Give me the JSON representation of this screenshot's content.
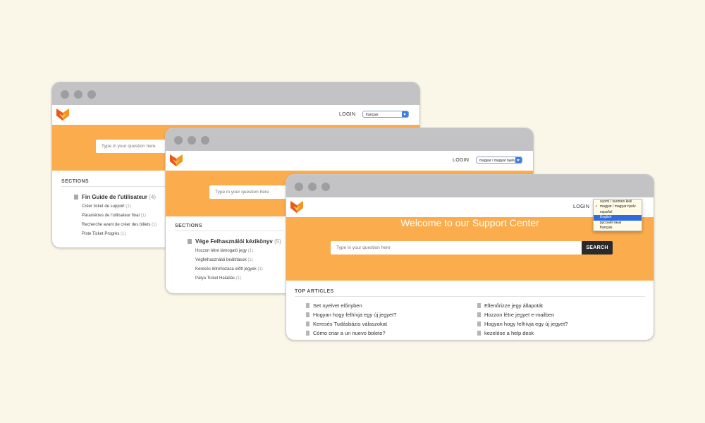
{
  "win1": {
    "nav": {
      "login": "LOGIN",
      "lang_selected": "français"
    },
    "search": {
      "placeholder": "Type in your question here"
    },
    "sections": {
      "title": "SECTIONS",
      "folder": {
        "label": "Fin Guide de l'utilisateur",
        "count": "(4)"
      },
      "items": [
        {
          "label": "Créer ticket de support",
          "count": "(1)"
        },
        {
          "label": "Paramètres de l'utilisateur final",
          "count": "(1)"
        },
        {
          "label": "Recherche avant de créer des billets",
          "count": "(1)"
        },
        {
          "label": "Piste Ticket Progrès",
          "count": "(1)"
        }
      ]
    }
  },
  "win2": {
    "nav": {
      "login": "LOGIN",
      "lang_selected": "magyar / magyar nyelv"
    },
    "search": {
      "placeholder": "Type in your question here"
    },
    "sections": {
      "title": "SECTIONS",
      "folder": {
        "label": "Vége Felhasználói kézikönyv",
        "count": "(5)"
      },
      "items": [
        {
          "label": "Hozzon létre támogató jegy",
          "count": "(1)"
        },
        {
          "label": "Végfelhasználói beállítások",
          "count": "(1)"
        },
        {
          "label": "Keresés létrehozása előtt jegyek",
          "count": "(1)"
        },
        {
          "label": "Pálya Ticket Haladás",
          "count": "(1)"
        }
      ]
    }
  },
  "win3": {
    "nav": {
      "login": "LOGIN"
    },
    "language_dropdown": {
      "options": [
        {
          "label": "suomi / suomen kieli",
          "checked": false,
          "highlighted": false
        },
        {
          "label": "magyar / magyar nyelv",
          "checked": true,
          "highlighted": false
        },
        {
          "label": "español",
          "checked": false,
          "highlighted": false
        },
        {
          "label": "English",
          "checked": false,
          "highlighted": true
        },
        {
          "label": "русский язык",
          "checked": false,
          "highlighted": false
        },
        {
          "label": "français",
          "checked": false,
          "highlighted": false
        }
      ],
      "check_glyph": "✓"
    },
    "hero": {
      "welcome": "Welcome to our Support Center"
    },
    "search": {
      "placeholder": "Type in your question here",
      "button": "SEARCH"
    },
    "top_articles": {
      "title": "TOP ARTICLES",
      "left": [
        "Set nyelvet előnyben",
        "Hogyan hogy felhívja egy új jegyet?",
        "Keresés Tudásbázis válaszokat",
        "Cómo criar a un nuevo boleto?"
      ],
      "right": [
        "Ellenőrizze jegy állapotát",
        "Hozzon létre jegyet e-mailben",
        "Hogyan hogy felhívja egy új jegyet?",
        "kezelése a help desk"
      ]
    }
  },
  "colors": {
    "orange": "#fbac4c",
    "titlebar": "#c3c3c5",
    "dot": "#9e9ea0",
    "background": "#fbf7e8",
    "button": "#2a2a2a"
  }
}
